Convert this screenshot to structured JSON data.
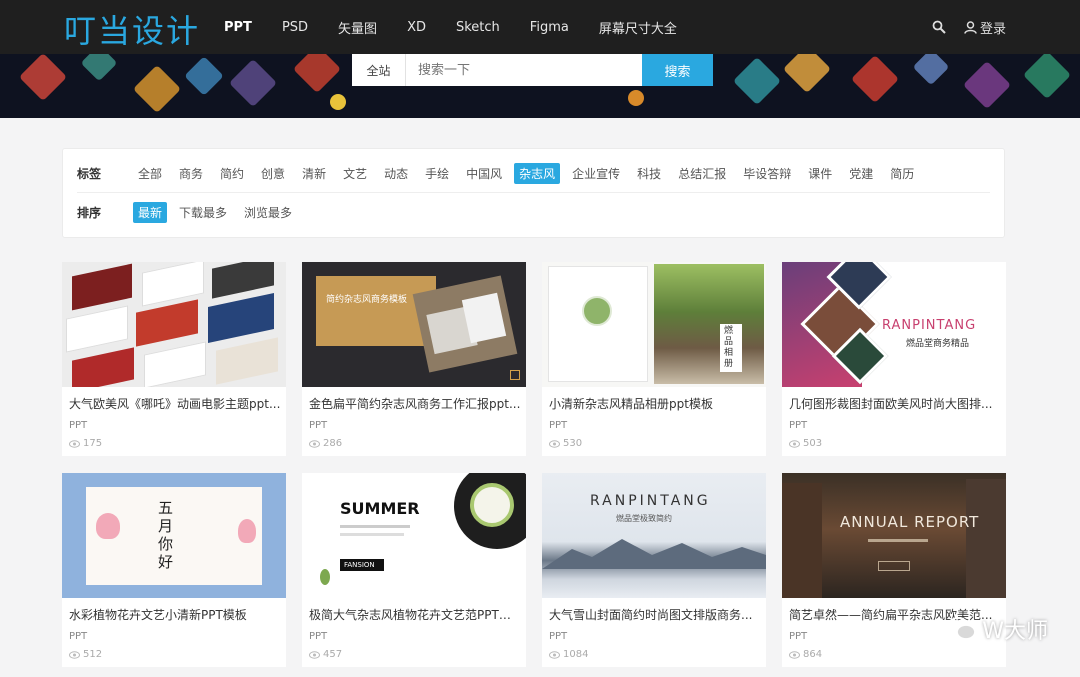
{
  "brand": {
    "logo": "叮当设计",
    "accent": "#2aa8e0"
  },
  "nav": {
    "items": [
      "PPT",
      "PSD",
      "矢量图",
      "XD",
      "Sketch",
      "Figma",
      "屏幕尺寸大全"
    ]
  },
  "header": {
    "login": "登录"
  },
  "search": {
    "scope": "全站",
    "placeholder": "搜索一下",
    "button": "搜索"
  },
  "filters": {
    "tags_label": "标签",
    "tags": [
      "全部",
      "商务",
      "简约",
      "创意",
      "清新",
      "文艺",
      "动态",
      "手绘",
      "中国风",
      "杂志风",
      "企业宣传",
      "科技",
      "总结汇报",
      "毕设答辩",
      "课件",
      "党建",
      "简历"
    ],
    "active_tag": "杂志风",
    "sort_label": "排序",
    "sorts": [
      "最新",
      "下载最多",
      "浏览最多"
    ],
    "active_sort": "最新"
  },
  "cards": [
    {
      "title": "大气欧美风《哪吒》动画电影主题ppt...",
      "tag": "PPT",
      "views": "175"
    },
    {
      "title": "金色扁平简约杂志风商务工作汇报ppt...",
      "tag": "PPT",
      "views": "286",
      "thumb_text": "简约杂志风商务模板"
    },
    {
      "title": "小清新杂志风精品相册ppt模板",
      "tag": "PPT",
      "views": "530",
      "thumb_text": "燃品相册"
    },
    {
      "title": "几何图形裁图封面欧美风时尚大图排...",
      "tag": "PPT",
      "views": "503",
      "thumb_text": "RANPINTANG",
      "thumb_sub": "燃品堂商务精品"
    },
    {
      "title": "水彩植物花卉文艺小清新PPT模板",
      "tag": "PPT",
      "views": "512",
      "thumb_text": "五月你好"
    },
    {
      "title": "极简大气杂志风植物花卉文艺范PPT模...",
      "tag": "PPT",
      "views": "457",
      "thumb_text": "SUMMER",
      "thumb_sub": "FANSION"
    },
    {
      "title": "大气雪山封面简约时尚图文排版商务...",
      "tag": "PPT",
      "views": "1084",
      "thumb_text": "RANPINTANG",
      "thumb_sub": "燃品堂极致简约"
    },
    {
      "title": "简艺卓然——简约扁平杂志风欧美范...",
      "tag": "PPT",
      "views": "864",
      "thumb_text": "ANNUAL REPORT"
    }
  ],
  "watermark": "W大师"
}
